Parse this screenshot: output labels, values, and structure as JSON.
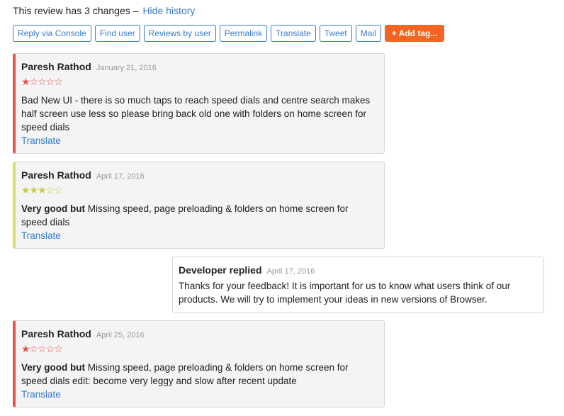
{
  "history": {
    "text": "This review has 3 changes –",
    "hide_link": "Hide history"
  },
  "actions": [
    {
      "name": "reply-via-console-button",
      "label": "Reply via Console"
    },
    {
      "name": "find-user-button",
      "label": "Find user"
    },
    {
      "name": "reviews-by-user-button",
      "label": "Reviews by user"
    },
    {
      "name": "permalink-button",
      "label": "Permalink"
    },
    {
      "name": "translate-button",
      "label": "Translate"
    },
    {
      "name": "tweet-button",
      "label": "Tweet"
    },
    {
      "name": "mail-button",
      "label": "Mail"
    }
  ],
  "add_tag": {
    "label": "Add tag...",
    "icon": "plus-icon"
  },
  "colors": {
    "accent": "#3a7bc8",
    "orange": "#f26522",
    "red_bar": "#e8554e",
    "yellow_bar": "#d8dc6a"
  },
  "reviews": [
    {
      "author": "Paresh Rathod",
      "date": "January 21, 2016",
      "rating": 1,
      "stars": "★☆☆☆☆",
      "bold": "",
      "text": "Bad New UI - there is so much taps to reach speed dials and centre search makes half screen use less so please bring back old one with folders on home screen for speed dials",
      "translate": "Translate"
    },
    {
      "author": "Paresh Rathod",
      "date": "April 17, 2016",
      "rating": 3,
      "stars": "★★★☆☆",
      "bold": "Very good but",
      "text": " Missing speed, page preloading & folders on home screen for speed dials",
      "translate": "Translate"
    },
    {
      "author": "Paresh Rathod",
      "date": "April 25, 2016",
      "rating": 1,
      "stars": "★☆☆☆☆",
      "bold": "Very good but",
      "text": " Missing speed, page preloading & folders on home screen for speed dials edit: become very leggy and slow after recent update",
      "translate": "Translate"
    }
  ],
  "reply": {
    "author": "Developer replied",
    "date": "April 17, 2016",
    "text": "Thanks for your feedback! It is important for us to know what users think of our products. We will try to implement your ideas in new versions of Browser."
  }
}
